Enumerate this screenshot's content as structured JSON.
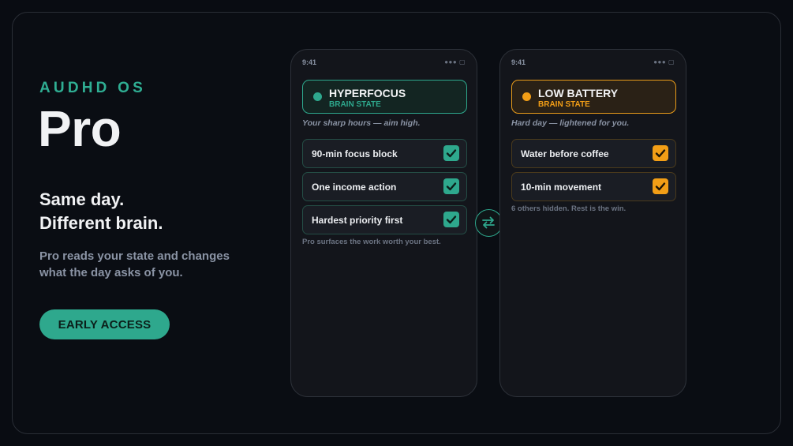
{
  "brand": {
    "eyebrow": "AUDHD OS",
    "title": "Pro"
  },
  "hero": {
    "headline_line1": "Same day.",
    "headline_line2": "Different brain.",
    "description": "Pro reads your state and changes what the day asks of you.",
    "cta_label": "EARLY ACCESS"
  },
  "colors": {
    "accent_teal": "#2ea88d",
    "accent_amber": "#f29e16",
    "background": "#090c12"
  },
  "phones": {
    "left": {
      "time": "9:41",
      "status_icons": "●●● ▢",
      "state_title": "HYPERFOCUS",
      "state_sub": "BRAIN STATE",
      "tagline": "Your sharp hours — aim high.",
      "tasks": [
        {
          "label": "90-min focus block",
          "checked": true
        },
        {
          "label": "One income action",
          "checked": true
        },
        {
          "label": "Hardest priority first",
          "checked": true
        }
      ],
      "footnote": "Pro surfaces the work worth your best."
    },
    "right": {
      "time": "9:41",
      "status_icons": "●●● ▢",
      "state_title": "LOW BATTERY",
      "state_sub": "BRAIN STATE",
      "tagline": "Hard day — lightened for you.",
      "tasks": [
        {
          "label": "Water before coffee",
          "checked": true
        },
        {
          "label": "10-min movement",
          "checked": true
        }
      ],
      "footnote": "6 others hidden. Rest is the win."
    }
  },
  "icons": {
    "swap": "swap-arrows-icon",
    "check": "checkmark-icon",
    "dot": "status-dot-icon"
  }
}
